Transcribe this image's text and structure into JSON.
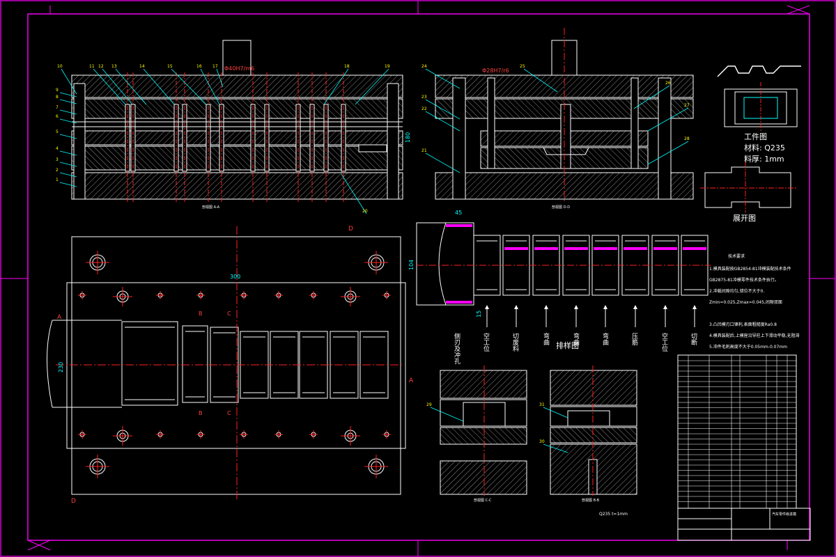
{
  "colors": {
    "background": "#000000",
    "frame": "#ff00ff",
    "outline": "#ffffff",
    "centerline": "#ff2020",
    "dimension": "#00ffff",
    "leader": "#00ffff",
    "label": "#ffff00",
    "hatch": "#9a9a9a",
    "highlight": "#ff00ff"
  },
  "section_titles": {
    "section_aa": "剖视图 A-A",
    "section_dd": "剖视图 D-D",
    "section_cc": "剖视图 C-C",
    "section_bb": "剖视图 B-B"
  },
  "fit_labels": {
    "left": "Φ40H7/m6",
    "right": "Φ28H7/r6"
  },
  "part_numbers_top_left": [
    "10",
    "11",
    "12",
    "13",
    "14",
    "15",
    "16",
    "17",
    "18",
    "19"
  ],
  "part_numbers_left_side": [
    "9",
    "8",
    "7",
    "6",
    "5",
    "4",
    "3",
    "2",
    "1"
  ],
  "part_number_bottom_aa": "20",
  "part_numbers_dd_left": [
    "24",
    "23",
    "22",
    "21"
  ],
  "part_numbers_dd_right": [
    "25",
    "26",
    "27",
    "28"
  ],
  "part_numbers_cc": [
    "29"
  ],
  "part_numbers_bb": [
    "31",
    "30"
  ],
  "dimensions": {
    "aa_height": "180",
    "plan_width": "300",
    "plan_height": "230",
    "strip_pitch": "45",
    "strip_width": "104",
    "strip_offset": "15"
  },
  "section_markers": {
    "a": "A",
    "b": "B",
    "c": "C",
    "d": "D"
  },
  "workpiece": {
    "title": "工件图",
    "material": "材料: Q235",
    "thickness": "料厚: 1mm"
  },
  "unfold_title": "展开图",
  "strip_title": "排样图",
  "strip_steps": [
    "侧刃及冲孔",
    "空工位",
    "切废料",
    "弯曲",
    "弯曲",
    "弯曲",
    "压筋",
    "空工位",
    "切断"
  ],
  "tech_requirements": {
    "title": "技术要求",
    "lines": [
      "1.模具装配按GB2854-81冲模装配技术条件",
      "GB2875-81冲模零件技术条件执行。",
      "2.冲裁间隙均匀,错位不大于0.",
      "Zmin=0.025,Zmax=0.045,间隙双面",
      "",
      "3.凸凹模刃口锋利,表面粗糙度Ra0.8",
      "4.模具装配后,上模座沿导柱上下滑动平稳,无阻滞",
      "5.冲件毛刺高度不大于0.05mm-0.07mm"
    ]
  },
  "title_block": {
    "material_spec": "Q235 t=1mm",
    "drawing_name": "汽车零件级进模"
  }
}
